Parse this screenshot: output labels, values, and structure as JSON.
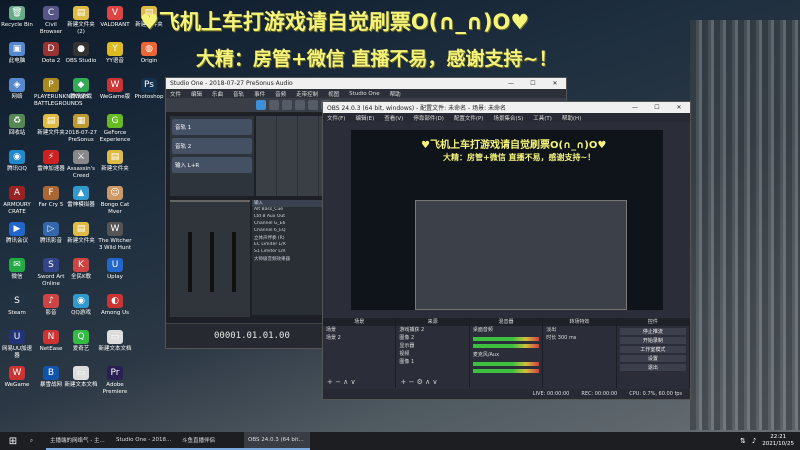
{
  "overlay": {
    "line1": "♥飞机上车打游戏请自觉刷票O(∩_∩)O♥",
    "line2": "大精：房管+微信 直播不易，感谢支持~！"
  },
  "desktop": {
    "icons": [
      {
        "label": "Recycle Bin",
        "glyph": "🗑",
        "color": "#6a8"
      },
      {
        "label": "此电脑",
        "glyph": "▣",
        "color": "#58c"
      },
      {
        "label": "网络",
        "glyph": "◈",
        "color": "#58c"
      },
      {
        "label": "回收站",
        "glyph": "♻",
        "color": "#585"
      },
      {
        "label": "腾讯QQ",
        "glyph": "◉",
        "color": "#28c"
      },
      {
        "label": "ARMOURY CRATE",
        "glyph": "A",
        "color": "#922"
      },
      {
        "label": "腾讯会议",
        "glyph": "▶",
        "color": "#26c"
      },
      {
        "label": "微信",
        "glyph": "✉",
        "color": "#2a4"
      },
      {
        "label": "Steam",
        "glyph": "S",
        "color": "#234"
      },
      {
        "label": "网易UU加速器",
        "glyph": "U",
        "color": "#237"
      },
      {
        "label": "WeGame",
        "glyph": "W",
        "color": "#c33"
      },
      {
        "label": "Civil Browser",
        "glyph": "C",
        "color": "#558"
      },
      {
        "label": "Dota 2",
        "glyph": "D",
        "color": "#933"
      },
      {
        "label": "PLAYERUNKNOWN'S BATTLEGROUNDS",
        "glyph": "P",
        "color": "#a82"
      },
      {
        "label": "新建文件夹",
        "glyph": "▤",
        "color": "#db4"
      },
      {
        "label": "雷神加速器",
        "glyph": "⚡",
        "color": "#c22"
      },
      {
        "label": "Far Cry 5",
        "glyph": "F",
        "color": "#a63"
      },
      {
        "label": "腾讯影音",
        "glyph": "▷",
        "color": "#36a"
      },
      {
        "label": "Sword Art Online",
        "glyph": "S",
        "color": "#348"
      },
      {
        "label": "影音",
        "glyph": "♪",
        "color": "#c44"
      },
      {
        "label": "NetEase",
        "glyph": "N",
        "color": "#c33"
      },
      {
        "label": "暴雪战网",
        "glyph": "B",
        "color": "#15a"
      },
      {
        "label": "新建文件夹 (2)",
        "glyph": "▤",
        "color": "#db4"
      },
      {
        "label": "OBS Studio",
        "glyph": "●",
        "color": "#333"
      },
      {
        "label": "腾讯游戏",
        "glyph": "◆",
        "color": "#3a5"
      },
      {
        "label": "2018-07-27 PreSonus",
        "glyph": "▦",
        "color": "#b93"
      },
      {
        "label": "Assassin's Creed",
        "glyph": "⚔",
        "color": "#888"
      },
      {
        "label": "雷神模拟器",
        "glyph": "▲",
        "color": "#39c"
      },
      {
        "label": "新建文件夹",
        "glyph": "▤",
        "color": "#db4"
      },
      {
        "label": "全民K歌",
        "glyph": "K",
        "color": "#c44"
      },
      {
        "label": "QQ游戏",
        "glyph": "◉",
        "color": "#39c"
      },
      {
        "label": "爱奇艺",
        "glyph": "Q",
        "color": "#3b4"
      },
      {
        "label": "新建文本文档",
        "glyph": "▭",
        "color": "#ddd"
      },
      {
        "label": "VALORANT",
        "glyph": "V",
        "color": "#d44"
      },
      {
        "label": "YY语音",
        "glyph": "Y",
        "color": "#db2"
      },
      {
        "label": "WeGame版",
        "glyph": "W",
        "color": "#c33"
      },
      {
        "label": "GeForce Experience",
        "glyph": "G",
        "color": "#6b2"
      },
      {
        "label": "新建文件夹",
        "glyph": "▤",
        "color": "#db4"
      },
      {
        "label": "Bongo Cat Mver",
        "glyph": "☺",
        "color": "#c96"
      },
      {
        "label": "The Witcher 3 Wild Hunt",
        "glyph": "W",
        "color": "#555"
      },
      {
        "label": "Uplay",
        "glyph": "U",
        "color": "#26c"
      },
      {
        "label": "Among Us",
        "glyph": "◐",
        "color": "#c33"
      },
      {
        "label": "新建文本文档",
        "glyph": "▭",
        "color": "#ddd"
      },
      {
        "label": "Adobe Premiere",
        "glyph": "Pr",
        "color": "#2a1f55"
      },
      {
        "label": "新建文件夹",
        "glyph": "▤",
        "color": "#db4"
      },
      {
        "label": "Origin",
        "glyph": "◍",
        "color": "#e63"
      },
      {
        "label": "Photoshop",
        "glyph": "Ps",
        "color": "#14314f"
      }
    ]
  },
  "studio_one": {
    "title": "Studio One - 2018-07-27 PreSonus Audio",
    "menu": [
      "文件",
      "编辑",
      "乐曲",
      "音轨",
      "事件",
      "音频",
      "走带控制",
      "视图",
      "Studio One",
      "帮助"
    ],
    "tracks": [
      "音轨 1",
      "音轨 2",
      "输入 L+R"
    ],
    "browser_header": "输入",
    "browser_items": [
      "Alt Bass_Cue",
      "Ltd 8 Aux Out",
      "Channel G_E6",
      "Channel 6_EQ",
      "立体声伴奏 (R)",
      "EC Limiter L/R",
      "S1 Limiter L/R",
      "大师级音频效果器"
    ],
    "time_display": "00001.01.01.00"
  },
  "obs": {
    "title": "OBS 24.0.3 (64 bit, windows) - 配置文件: 未命名 - 场景: 未命名",
    "menu": [
      "文件(F)",
      "编辑(E)",
      "查看(V)",
      "停靠部件(D)",
      "配置文件(P)",
      "场景集合(S)",
      "工具(T)",
      "帮助(H)"
    ],
    "preview_text1": "♥飞机上车打游戏请自觉刷票O(∩_∩)O♥",
    "preview_text2": "大精：房管+微信 直播不易，感谢支持~！",
    "docks": {
      "scenes": {
        "header": "场景",
        "items": [
          "场景",
          "场景 2"
        ]
      },
      "sources": {
        "header": "来源",
        "items": [
          "游戏捕获 2",
          "图像 2",
          "显示器",
          "视频",
          "图像 1"
        ]
      },
      "mixer": {
        "header": "混音器",
        "items": [
          "桌面音频",
          "麦克风/Aux"
        ]
      },
      "transitions": {
        "header": "转场特效",
        "items": [
          "淡出",
          "时长 300 ms"
        ]
      },
      "controls": {
        "header": "控件",
        "items": [
          "停止推流",
          "开始录制",
          "工作室模式",
          "设置",
          "退出"
        ]
      }
    },
    "status": [
      "LIVE: 00:00:00",
      "REC: 00:00:00",
      "CPU: 0.7%, 60.00 fps"
    ]
  },
  "taskbar": {
    "apps": [
      "主播端的网络气 - 主...",
      "Studio One - 2018...",
      "斗鱼直播伴侣",
      "OBS 24.0.3 (64 bit..."
    ],
    "time": "22:21",
    "date": "2021/10/25"
  }
}
